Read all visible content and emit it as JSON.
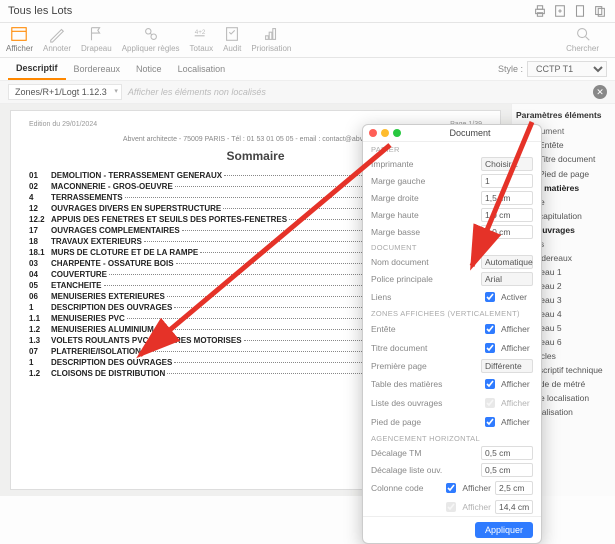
{
  "titlebar": {
    "title": "Tous les Lots"
  },
  "toolbar": {
    "afficher": "Afficher",
    "annoter": "Annoter",
    "drapeau": "Drapeau",
    "regles": "Appliquer règles",
    "totaux": "Totaux",
    "audit": "Audit",
    "prio": "Priorisation",
    "chercher": "Chercher"
  },
  "tabs": {
    "descriptif": "Descriptif",
    "bordereaux": "Bordereaux",
    "notice": "Notice",
    "localisation": "Localisation",
    "style_label": "Style :",
    "style_value": "CCTP T1"
  },
  "crumb": {
    "path": "Zones/R+1/Logt 1.12.3",
    "hint": "Afficher les éléments non localisés"
  },
  "doc": {
    "edition": "Edition du 29/01/2024",
    "page": "Page 1/39",
    "firm": "Abvent architecte - 75009 PARIS - Tél : 01 53 01 05 05 - email : contact@abvent.com",
    "title": "Sommaire",
    "toc": [
      {
        "n": "01",
        "t": "DEMOLITION - TERRASSEMENT GENERAUX"
      },
      {
        "n": "02",
        "t": "MACONNERIE - GROS-OEUVRE"
      },
      {
        "n": "4",
        "t": "TERRASSEMENTS"
      },
      {
        "n": "12",
        "t": "OUVRAGES DIVERS EN SUPERSTRUCTURE"
      },
      {
        "n": "12.2",
        "t": "APPUIS DES FENETRES ET SEUILS DES PORTES-FENETRES"
      },
      {
        "n": "17",
        "t": "OUVRAGES COMPLEMENTAIRES"
      },
      {
        "n": "18",
        "t": "TRAVAUX EXTERIEURS"
      },
      {
        "n": "18.1",
        "t": "MURS DE CLOTURE ET DE LA RAMPE"
      },
      {
        "n": "03",
        "t": "CHARPENTE - OSSATURE BOIS"
      },
      {
        "n": "04",
        "t": "COUVERTURE"
      },
      {
        "n": "05",
        "t": "ETANCHEITE"
      },
      {
        "n": "06",
        "t": "MENUISERIES EXTERIEURES"
      },
      {
        "n": "1",
        "t": "DESCRIPTION DES OUVRAGES"
      },
      {
        "n": "1.1",
        "t": "MENUISERIES PVC"
      },
      {
        "n": "1.2",
        "t": "MENUISERIES ALUMINIUM"
      },
      {
        "n": "1.3",
        "t": "VOLETS ROULANTS PVC INTEGRES MOTORISES"
      },
      {
        "n": "07",
        "t": "PLATRERIE/ISOLATION"
      },
      {
        "n": "1",
        "t": "DESCRIPTION DES OUVRAGES"
      },
      {
        "n": "1.2",
        "t": "CLOISONS DE DISTRIBUTION"
      }
    ]
  },
  "popup": {
    "title": "Document",
    "sec_papier": "PAPIER",
    "imprimante": "Imprimante",
    "choisir": "Choisir...",
    "mg": "Marge gauche",
    "mg_v": "1",
    "md": "Marge droite",
    "md_v": "1,5 cm",
    "mh": "Marge haute",
    "mh_v": "1,0 cm",
    "mb": "Marge basse",
    "mb_v": "0,0 cm",
    "sec_doc": "DOCUMENT",
    "nomdoc": "Nom document",
    "nomdoc_v": "Automatique",
    "police": "Police principale",
    "police_v": "Arial",
    "liens": "Liens",
    "activer": "Activer",
    "sec_zones": "ZONES AFFICHEES (VERTICALEMENT)",
    "entete": "Entête",
    "titredoc": "Titre document",
    "premiere": "Première page",
    "premiere_v": "Différente",
    "tdm": "Table des matières",
    "liste": "Liste des ouvrages",
    "pied": "Pied de page",
    "afficher": "Afficher",
    "sec_agc": "AGENCEMENT HORIZONTAL",
    "dtm": "Décalage TM",
    "dtm_v": "0,5 cm",
    "dlo": "Décalage liste ouv.",
    "dlo_v": "0,5 cm",
    "colcode": "Colonne code",
    "colcode_v": "2,5 cm",
    "colu": "",
    "colu_v": "14,4 cm",
    "apply": "Appliquer"
  },
  "tree": {
    "title": "Paramètres éléments",
    "grp_doc": "Document",
    "entete": "Entête",
    "titredoc": "Titre document",
    "pied": "Pied de page",
    "grp_tdm": "e des matières",
    "titre": "Titre",
    "recap": "Récapitulation",
    "grp_ouv": "des ouvrages",
    "lots": "Lots",
    "bordereaux": "Bordereaux",
    "n1": "Niveau 1",
    "n2": "Niveau 2",
    "n3": "Niveau 3",
    "n4": "Niveau 4",
    "n5": "Niveau 5",
    "n6": "Niveau 6",
    "articles": "Articles",
    "desc": "Descriptif technique",
    "mode": "Mode de métré",
    "tloc": "Titre localisation",
    "loc": "Localisation"
  }
}
